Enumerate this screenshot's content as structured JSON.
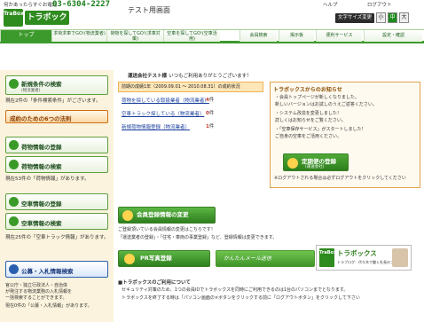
{
  "header": {
    "tagline": "何かあったらすぐお電話",
    "phone": "03-6304-2227",
    "logo_badge": "TraBox",
    "logo_name": "トラボックス",
    "page_title": "テスト用画面",
    "help_link": "ヘルプ",
    "logout_link": "ログアウト",
    "fontsize_label": "文字サイズ変更",
    "font_sizes": [
      "小",
      "中",
      "大"
    ]
  },
  "nav": {
    "items": [
      {
        "label": "トップ"
      },
      {
        "label": "求荷求車でGO!(物流業者)"
      },
      {
        "label": "荷物を探してGO!(求車対策)"
      },
      {
        "label": "空車を探してGO!(空車活用)"
      },
      {
        "label": "会員検索"
      },
      {
        "label": "掲示板"
      },
      {
        "label": "便利サービス"
      },
      {
        "label": "設定・確認"
      }
    ]
  },
  "sidebar": {
    "search_cond": {
      "label": "新規条件の検索",
      "sub": "(物流業者)"
    },
    "search_note": "現在2件の「条件検索条件」がございます。",
    "success_tips": {
      "label": "成約のための6つの法則"
    },
    "cargo_register": {
      "label": "荷物情報の登録"
    },
    "cargo_search": {
      "label": "荷物情報の検索"
    },
    "cargo_note": "現在53件の「荷物情報」があります。",
    "truck_register": {
      "label": "空車情報の登録"
    },
    "truck_search": {
      "label": "空車情報の検索"
    },
    "truck_note": "現在25件の「空車トラック情報」があります。",
    "bid_search": {
      "label": "公募・入札情報検索"
    },
    "bid_note_1": "官公庁・独立行政法人・自治体",
    "bid_note_2": "が発注する物流業務の入札情報を",
    "bid_note_3": "一括検索することができます。",
    "bid_note_4": "現在0件の「公募・入札情報」があります。"
  },
  "main": {
    "notice_title": "運送会社テスト様",
    "notice_title_suffix": "いつもご利用ありがとうございます！",
    "period_note": "前期の成績1年（2009.09.01 〜 2010.08.31）の成約状況",
    "stats": [
      {
        "label": "荷物を探している取扱業者（物流業者）",
        "count": "4",
        "unit": "件"
      },
      {
        "label": "空車トラック探している（物流業者）",
        "count": "0",
        "unit": "件"
      },
      {
        "label": "新規荷物情報登録（物流業者）",
        "count": "1",
        "unit": "件"
      }
    ],
    "news": {
      "title": "トラボックスからのお知らせ",
      "lines": [
        "・会員トップページが新しくなりました。",
        "  新しいバージョンはお試しのうえご返答ください。",
        "・システム改造を変更しました！",
        "  詳しくはお知らせをご覧ください。",
        "・「空車保存サービス」がスタートしました！",
        "  ご自身の空車をご活用ください。"
      ],
      "register_btn": "定期便の登録",
      "register_btn_sub": "(運送会社)",
      "footer": "※ログアウトされる場合は必ずログアウトをクリックしてください"
    },
    "member_btn": "会員登録情報の変更",
    "member_info_1": "ご登録頂いている会員情報の変更はこちらです！",
    "member_info_2": "「運送業者の登録」・「住宅・車両の事業登録」など、登録情報は変更できます。",
    "pr_btn": "PR写真登録",
    "easy_btn": "かんたんメール送信",
    "blog": {
      "badge": "TraBox",
      "name": "トラボックス",
      "sub": "トラブログ：代々木で働く社長のブログ"
    },
    "usage_title": "■トラボックスのご利用について",
    "usage_lines": [
      "セキュリティ対策のため、1つの会員IDでトラボックスを同時にご利用できるのは1台のパソコンまでとなります。",
      "トラボックスを終了する時は「パソコン画面の×ボタンをクリックする前に「ログアウトボタン」をクリックして下さい"
    ]
  }
}
